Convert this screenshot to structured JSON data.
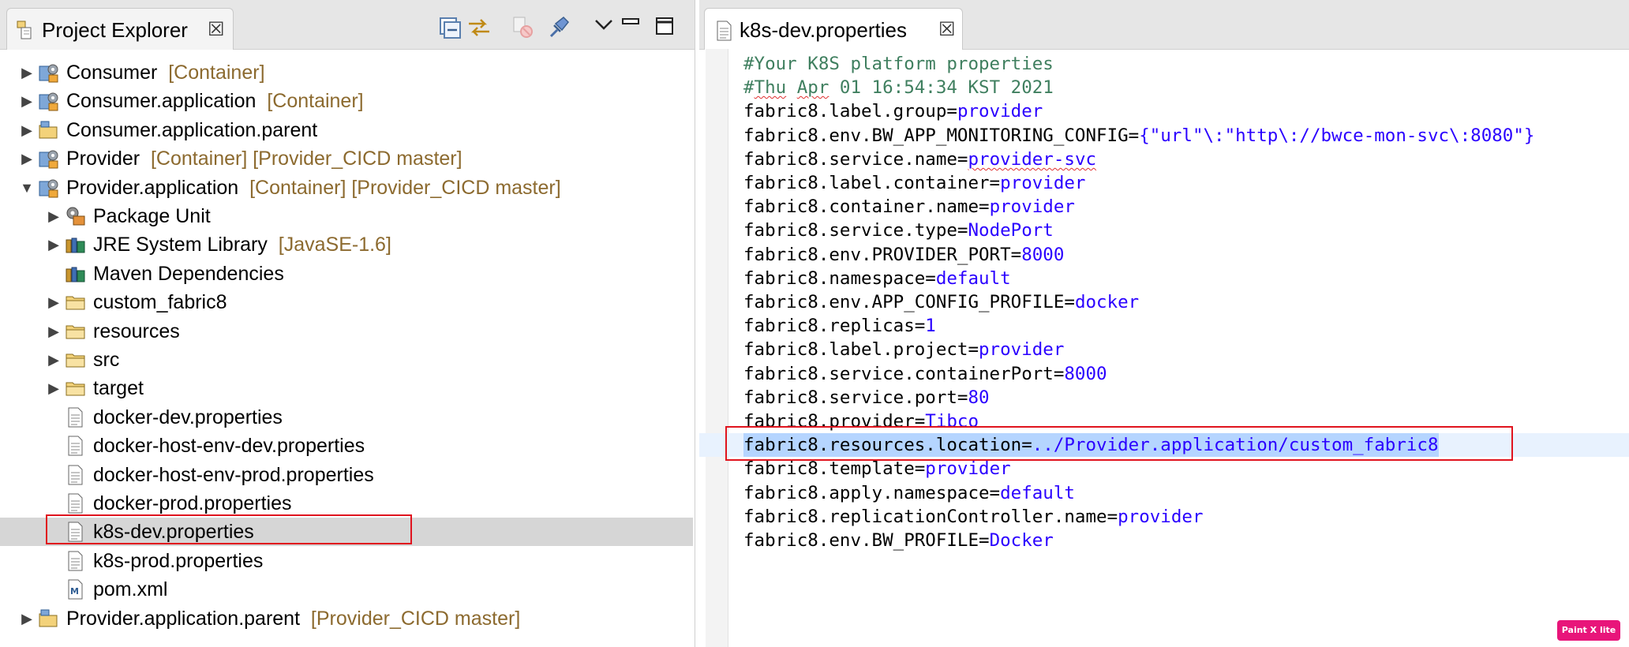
{
  "left_panel": {
    "tab_title": "Project Explorer",
    "tab_close_glyph": "☒",
    "toolbar_icons": [
      "collapse-all-icon",
      "link-with-editor-icon",
      "filter-disabled-icon",
      "pin-icon",
      "view-menu-chevron-icon",
      "minimize-icon",
      "maximize-icon"
    ],
    "tree": [
      {
        "label": "Consumer",
        "decoration": "[Container]",
        "expander": "▶",
        "icon": "container-project-icon"
      },
      {
        "label": "Consumer.application",
        "decoration": "[Container]",
        "expander": "▶",
        "icon": "container-project-icon"
      },
      {
        "label": "Consumer.application.parent",
        "decoration": "",
        "expander": "▶",
        "icon": "folder-project-icon"
      },
      {
        "label": "Provider",
        "decoration": "[Container] [Provider_CICD master]",
        "expander": "▶",
        "icon": "container-project-icon"
      },
      {
        "label": "Provider.application",
        "decoration": "[Container] [Provider_CICD master]",
        "expander": "▼",
        "icon": "container-project-icon"
      },
      {
        "label": "Package Unit",
        "decoration": "",
        "expander": "▶",
        "icon": "package-unit-icon"
      },
      {
        "label": "JRE System Library",
        "decoration": "[JavaSE-1.6]",
        "expander": "▶",
        "icon": "library-icon"
      },
      {
        "label": "Maven Dependencies",
        "decoration": "",
        "expander": "",
        "icon": "library-icon"
      },
      {
        "label": "custom_fabric8",
        "decoration": "",
        "expander": "▶",
        "icon": "folder-icon"
      },
      {
        "label": "resources",
        "decoration": "",
        "expander": "▶",
        "icon": "folder-icon"
      },
      {
        "label": "src",
        "decoration": "",
        "expander": "▶",
        "icon": "folder-icon"
      },
      {
        "label": "target",
        "decoration": "",
        "expander": "▶",
        "icon": "folder-icon"
      },
      {
        "label": "docker-dev.properties",
        "decoration": "",
        "expander": "",
        "icon": "properties-file-icon"
      },
      {
        "label": "docker-host-env-dev.properties",
        "decoration": "",
        "expander": "",
        "icon": "properties-file-icon"
      },
      {
        "label": "docker-host-env-prod.properties",
        "decoration": "",
        "expander": "",
        "icon": "properties-file-icon"
      },
      {
        "label": "docker-prod.properties",
        "decoration": "",
        "expander": "",
        "icon": "properties-file-icon"
      },
      {
        "label": "k8s-dev.properties",
        "decoration": "",
        "expander": "",
        "icon": "properties-file-icon",
        "selected": true
      },
      {
        "label": "k8s-prod.properties",
        "decoration": "",
        "expander": "",
        "icon": "properties-file-icon"
      },
      {
        "label": "pom.xml",
        "decoration": "",
        "expander": "",
        "icon": "maven-pom-icon"
      },
      {
        "label": "Provider.application.parent",
        "decoration": "[Provider_CICD master]",
        "expander": "▶",
        "icon": "folder-project-icon"
      }
    ]
  },
  "editor": {
    "tab_title": "k8s-dev.properties",
    "tab_close_glyph": "☒",
    "lines": [
      {
        "type": "comment",
        "text": "#Your K8S platform properties"
      },
      {
        "type": "comment",
        "text": "#Thu Apr 01 16:54:34 KST 2021"
      },
      {
        "type": "kv",
        "key": "fabric8.label.group",
        "value": "provider"
      },
      {
        "type": "kv",
        "key": "fabric8.env.BW_APP_MONITORING_CONFIG",
        "value": "{\"url\"\\:\"http\\://bwce-mon-svc\\:8080\"}"
      },
      {
        "type": "kv",
        "key": "fabric8.service.name",
        "value": "provider-svc"
      },
      {
        "type": "kv",
        "key": "fabric8.label.container",
        "value": "provider"
      },
      {
        "type": "kv",
        "key": "fabric8.container.name",
        "value": "provider"
      },
      {
        "type": "kv",
        "key": "fabric8.service.type",
        "value": "NodePort"
      },
      {
        "type": "kv",
        "key": "fabric8.env.PROVIDER_PORT",
        "value": "8000"
      },
      {
        "type": "kv",
        "key": "fabric8.namespace",
        "value": "default"
      },
      {
        "type": "kv",
        "key": "fabric8.env.APP_CONFIG_PROFILE",
        "value": "docker"
      },
      {
        "type": "kv",
        "key": "fabric8.replicas",
        "value": "1"
      },
      {
        "type": "kv",
        "key": "fabric8.label.project",
        "value": "provider"
      },
      {
        "type": "kv",
        "key": "fabric8.service.containerPort",
        "value": "8000"
      },
      {
        "type": "kv",
        "key": "fabric8.service.port",
        "value": "80"
      },
      {
        "type": "kv",
        "key": "fabric8.provider",
        "value": "Tibco"
      },
      {
        "type": "kv",
        "key": "fabric8.resources.location",
        "value": "../Provider.application/custom_fabric8",
        "selected": true,
        "current": true
      },
      {
        "type": "kv",
        "key": "fabric8.template",
        "value": "provider"
      },
      {
        "type": "kv",
        "key": "fabric8.apply.namespace",
        "value": "default"
      },
      {
        "type": "kv",
        "key": "fabric8.replicationController.name",
        "value": "provider"
      },
      {
        "type": "kv",
        "key": "fabric8.env.BW_PROFILE",
        "value": "Docker"
      }
    ]
  },
  "watermark": "Paint X lite",
  "colors": {
    "decoration": "#8c6a2f",
    "comment": "#3f7f5f",
    "value": "#2a00ff",
    "selection": "#b5d5ff",
    "current_line": "#e8f2fe",
    "highlight_box": "#e0141e"
  }
}
